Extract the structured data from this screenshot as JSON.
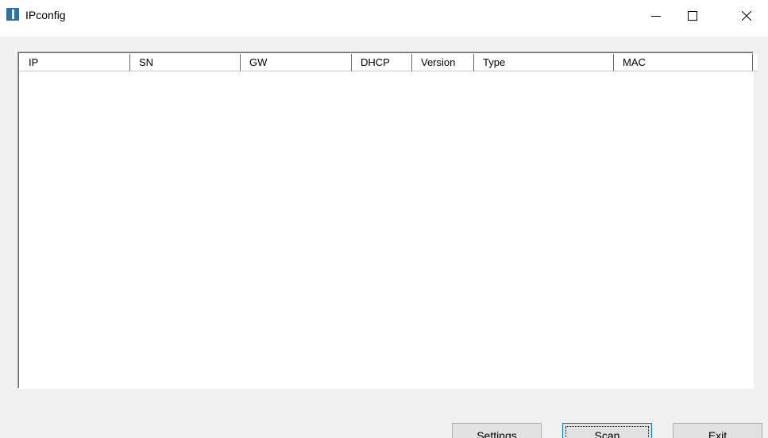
{
  "window": {
    "title": "IPconfig",
    "icon": "app-icon",
    "controls": {
      "minimize_icon": "minimize-icon",
      "maximize_icon": "maximize-icon",
      "close_icon": "close-icon"
    }
  },
  "table": {
    "columns": [
      "IP",
      "SN",
      "GW",
      "DHCP",
      "Version",
      "Type",
      "MAC"
    ],
    "rows": []
  },
  "buttons": {
    "settings": "Settings",
    "scan": "Scan",
    "exit": "Exit"
  },
  "colors": {
    "titlebar_bg": "#ffffff",
    "window_bg": "#f0f0f0",
    "button_bg": "#e1e1e1",
    "focus_border": "#0078d7",
    "app_icon": "#2f6fa7"
  }
}
